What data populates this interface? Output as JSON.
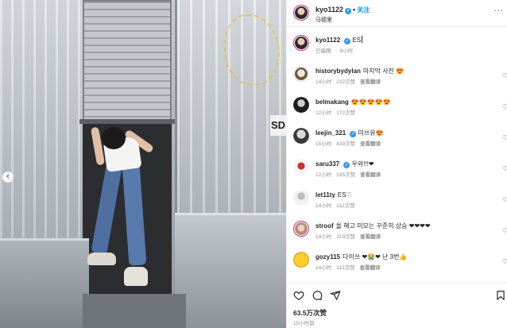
{
  "post": {
    "username": "kyo1122",
    "follow_label": "关注",
    "location": "马德里",
    "likes": "63.5万次赞",
    "timestamp": "15小时前"
  },
  "caption": {
    "username": "kyo1122",
    "text": "ES",
    "edited": "已编辑",
    "time": "8小时"
  },
  "comments": [
    {
      "user": "historybydylan",
      "text": "마지막 사진 😍",
      "time": "14小时",
      "likes": "232次赞",
      "reply": "查看翻译",
      "verified": false
    },
    {
      "user": "belmakang",
      "text": "😍😍😍😍😍",
      "time": "12小时",
      "likes": "172次赞",
      "reply": "",
      "verified": false
    },
    {
      "user": "leejin_321",
      "text": "미쓰유😍",
      "time": "15小时",
      "likes": "439次赞",
      "reply": "查看翻译",
      "verified": true
    },
    {
      "user": "saru337",
      "text": "우와!!!❤",
      "time": "12小时",
      "likes": "195次赞",
      "reply": "查看翻译",
      "verified": true
    },
    {
      "user": "let11ty",
      "text": "ES♡",
      "time": "14小时",
      "likes": "112次赞",
      "reply": "",
      "verified": false
    },
    {
      "user": "stroof",
      "text": "올 해고 미모는 꾸준히 상승 ❤❤❤❤",
      "time": "14小时",
      "likes": "319次赞",
      "reply": "查看翻译",
      "verified": false
    },
    {
      "user": "gozy115",
      "text": "다이쓰 ❤😭❤ 난 3번👍",
      "time": "14小时",
      "likes": "113次赞",
      "reply": "查看翻译",
      "verified": false
    }
  ],
  "photo": {
    "sign_text": "SD"
  },
  "icons": {
    "carousel_prev": "chevron-left-icon",
    "like": "heart-icon",
    "comment": "comment-icon",
    "share": "send-icon",
    "save": "bookmark-icon",
    "more": "more-icon"
  },
  "colors": {
    "accent": "#0095f6",
    "verified": "#3897f0",
    "muted": "#8e8e8e"
  }
}
